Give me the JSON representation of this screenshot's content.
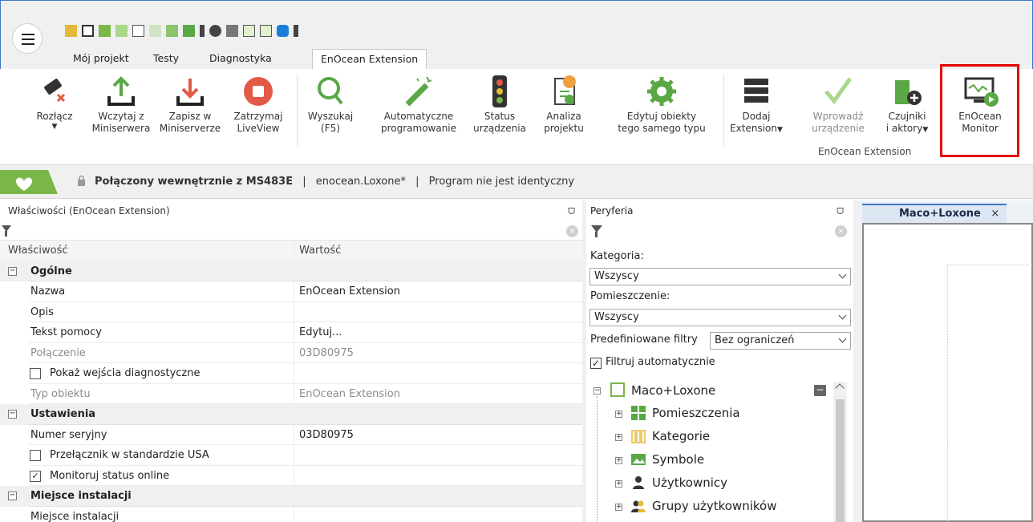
{
  "tabs": [
    {
      "label": "Mój projekt",
      "active": false
    },
    {
      "label": "Testy",
      "active": false
    },
    {
      "label": "Diagnostyka",
      "active": false
    },
    {
      "label": "EnOcean Extension",
      "active": true
    }
  ],
  "ribbon": {
    "buttons": {
      "disconnect": "Rozłącz",
      "load_from_server": "Wczytaj z\nMiniserwera",
      "save_to_server": "Zapisz w\nMiniserverze",
      "stop_liveview": "Zatrzymaj\nLiveView",
      "search": "Wyszukaj\n(F5)",
      "auto_program": "Automatyczne\nprogramowanie",
      "device_status": "Status\nurządzenia",
      "project_analysis": "Analiza\nprojektu",
      "edit_same_type": "Edytuj obiekty\ntego samego typu",
      "add_extension": "Dodaj\nExtension",
      "add_device": "Wprowadź\nurządzenie",
      "sensors_actors": "Czujniki\ni aktory",
      "enocean_monitor": "EnOcean\nMonitor"
    },
    "group_label": "EnOcean Extension"
  },
  "status": {
    "connection": "Połączony wewnętrznie z MS483E",
    "file": "enocean.Loxone*",
    "state": "Program nie jest identyczny",
    "separator": "|"
  },
  "properties": {
    "title": "Właściwości (EnOcean Extension)",
    "col_property": "Właściwość",
    "col_value": "Wartość",
    "rows": [
      {
        "type": "cat",
        "label": "Ogólne"
      },
      {
        "type": "prop",
        "label": "Nazwa",
        "value": "EnOcean Extension"
      },
      {
        "type": "prop",
        "label": "Opis",
        "value": ""
      },
      {
        "type": "prop",
        "label": "Tekst pomocy",
        "value": "Edytuj..."
      },
      {
        "type": "grey",
        "label": "Połączenie",
        "value": "03D80975"
      },
      {
        "type": "check",
        "label": "Pokaż wejścia diagnostyczne",
        "checked": false
      },
      {
        "type": "grey",
        "label": "Typ obiektu",
        "value": "EnOcean Extension"
      },
      {
        "type": "cat",
        "label": "Ustawienia"
      },
      {
        "type": "prop",
        "label": "Numer seryjny",
        "value": "03D80975"
      },
      {
        "type": "check",
        "label": "Przełącznik w standardzie USA",
        "checked": false
      },
      {
        "type": "check",
        "label": "Monitoruj status online",
        "checked": true
      },
      {
        "type": "cat",
        "label": "Miejsce instalacji"
      },
      {
        "type": "prop",
        "label": "Miejsce instalacji",
        "value": ""
      }
    ]
  },
  "peripherals": {
    "title": "Peryferia",
    "category_label": "Kategoria:",
    "category_value": "Wszyscy",
    "room_label": "Pomieszczenie:",
    "room_value": "Wszyscy",
    "predefined_label": "Predefiniowane filtry",
    "predefined_value": "Bez ograniczeń",
    "auto_filter_label": "Filtruj automatycznie",
    "auto_filter_checked": true,
    "tree": {
      "root": "Maco+Loxone",
      "children": [
        "Pomieszczenia",
        "Kategorie",
        "Symbole",
        "Użytkownicy",
        "Grupy użytkowników"
      ]
    }
  },
  "document": {
    "tab_label": "Maco+Loxone",
    "close_glyph": "×"
  },
  "icons": {
    "close": "×",
    "pin": "ᗜ",
    "clear": "×",
    "check": "✓",
    "dropdown": "▾",
    "minus": "−",
    "plus": "+"
  },
  "colors": {
    "accent": "#3c78c8",
    "highlight": "#e60000",
    "green_icon": "#7ab648",
    "red_icon": "#e05a47"
  }
}
